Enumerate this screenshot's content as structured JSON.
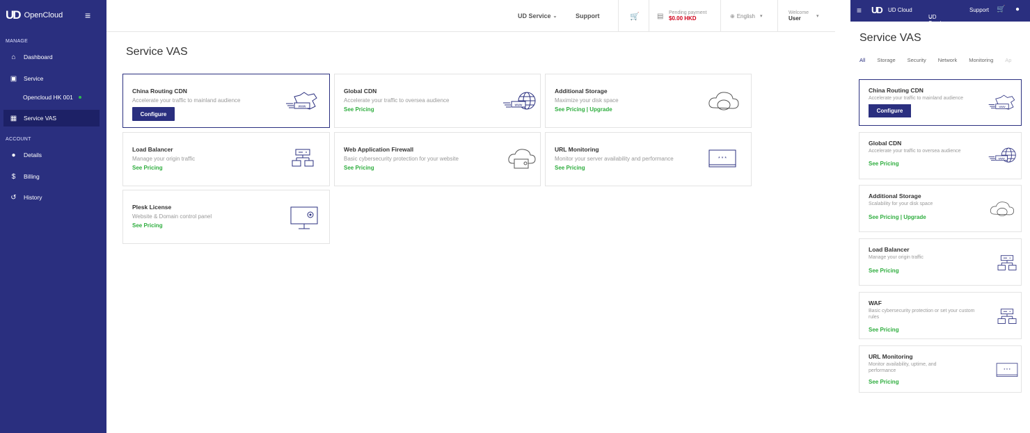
{
  "brand": {
    "name": "OpenCloud"
  },
  "sidebar": {
    "manage_label": "MANAGE",
    "account_label": "ACCOUNT",
    "items": [
      {
        "label": "Dashboard",
        "icon": "home-icon"
      },
      {
        "label": "Service",
        "icon": "service-icon"
      },
      {
        "label": "Opencloud HK 001",
        "icon": "status-dot"
      },
      {
        "label": "Service VAS",
        "icon": "grid-icon"
      },
      {
        "label": "Details",
        "icon": "person-icon"
      },
      {
        "label": "Billing",
        "icon": "dollar-icon"
      },
      {
        "label": "History",
        "icon": "history-icon"
      }
    ]
  },
  "header": {
    "ud_service": "UD Service",
    "support": "Support",
    "pending_label": "Pending payment",
    "pending_amount": "$0.00 HKD",
    "language": "English",
    "welcome": "Welcome",
    "user": "User"
  },
  "page_title": "Service VAS",
  "cards": [
    {
      "title": "China Routing CDN",
      "desc": "Accelerate your traffic to mainland audience",
      "action": "Configure"
    },
    {
      "title": "Global CDN",
      "desc": "Accelerate your traffic to oversea audience",
      "link": "See Pricing"
    },
    {
      "title": "Additional Storage",
      "desc": "Maximize your disk space",
      "link": "See Pricing | Upgrade"
    },
    {
      "title": "Load Balancer",
      "desc": "Manage your origin traffic",
      "link": "See Pricing"
    },
    {
      "title": "Web Application Firewall",
      "desc": "Basic cybersecurity protection for your website",
      "link": "See Pricing"
    },
    {
      "title": "URL Monitoring",
      "desc": "Monitor your server availability and performance",
      "link": "See Pricing"
    },
    {
      "title": "Plesk License",
      "desc": "Website & Domain control panel",
      "link": "See Pricing"
    }
  ],
  "mobile": {
    "brand": "UD Cloud",
    "ud_service": "UD Service",
    "support": "Support",
    "title": "Service VAS",
    "tabs": [
      "All",
      "Storage",
      "Security",
      "Network",
      "Monitoring",
      "Ap"
    ],
    "cards": [
      {
        "title": "China Routing CDN",
        "desc": "Accelerate your traffic to mainland audience",
        "action": "Configure"
      },
      {
        "title": "Global CDN",
        "desc": "Accelerate your traffic to oversea audience",
        "link": "See Pricing"
      },
      {
        "title": "Additional Storage",
        "desc": "Scalability for your disk space",
        "link": "See Pricing | Upgrade"
      },
      {
        "title": "Load Balancer",
        "desc": "Manage your origin traffic",
        "link": "See Pricing"
      },
      {
        "title": "WAF",
        "desc": "Basic cybersecurity protection or set your custom rules",
        "link": "See Pricing"
      },
      {
        "title": "URL Monitoring",
        "desc": "Monitor availability, uptime, and performance",
        "link": "See Pricing"
      }
    ]
  },
  "colors": {
    "primary": "#2a2f7f",
    "green": "#2fae3f",
    "red": "#d0021b"
  }
}
